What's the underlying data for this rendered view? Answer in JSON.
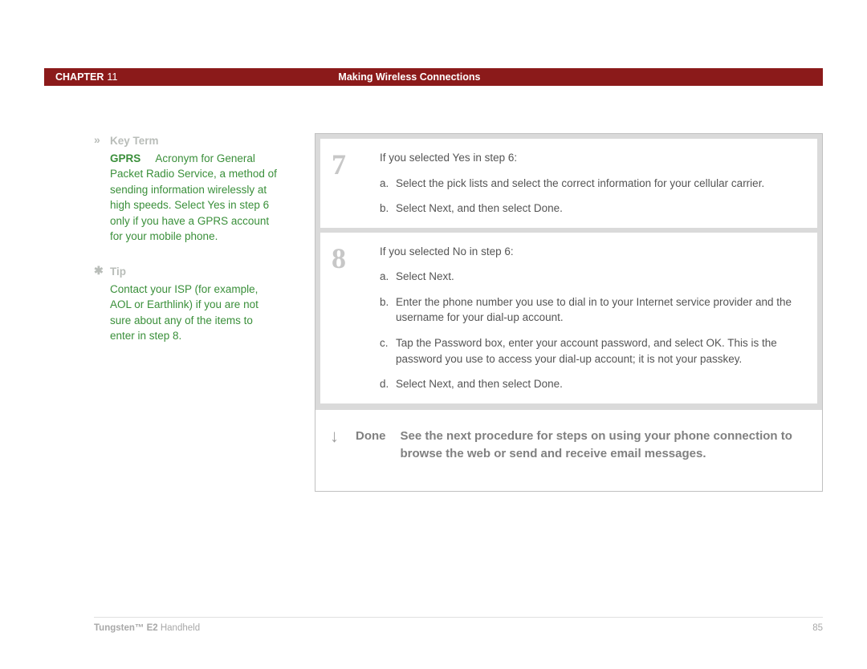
{
  "header": {
    "chapter_label": "CHAPTER",
    "chapter_num": "11",
    "title": "Making Wireless Connections"
  },
  "sidebar": {
    "keyterm": {
      "icon": "»",
      "label": "Key Term",
      "term": "GPRS",
      "text": "Acronym for General Packet Radio Service, a method of sending information wirelessly at high speeds. Select Yes in step 6 only if you have a GPRS account for your mobile phone."
    },
    "tip": {
      "icon": "✱",
      "label": "Tip",
      "text": "Contact your ISP (for example, AOL or Earthlink) if you are not sure about any of the items to enter in step 8."
    }
  },
  "steps": {
    "s7": {
      "num": "7",
      "intro": "If you selected Yes in step 6:",
      "items": [
        {
          "letter": "a.",
          "text": "Select the pick lists and select the correct information for your cellular carrier."
        },
        {
          "letter": "b.",
          "text": "Select Next, and then select Done."
        }
      ]
    },
    "s8": {
      "num": "8",
      "intro": "If you selected No in step 6:",
      "items": [
        {
          "letter": "a.",
          "text": "Select Next."
        },
        {
          "letter": "b.",
          "text": "Enter the phone number you use to dial in to your Internet service provider and the username for your dial-up account."
        },
        {
          "letter": "c.",
          "text": "Tap the Password box, enter your account password, and select OK. This is the password you use to access your dial-up account; it is not your passkey."
        },
        {
          "letter": "d.",
          "text": "Select Next, and then select Done."
        }
      ]
    }
  },
  "done": {
    "arrow": "↓",
    "label": "Done",
    "text": "See the next procedure for steps on using your phone connection to browse the web or send and receive email messages."
  },
  "footer": {
    "product_bold": "Tungsten™ E2",
    "product_rest": " Handheld",
    "page": "85"
  }
}
